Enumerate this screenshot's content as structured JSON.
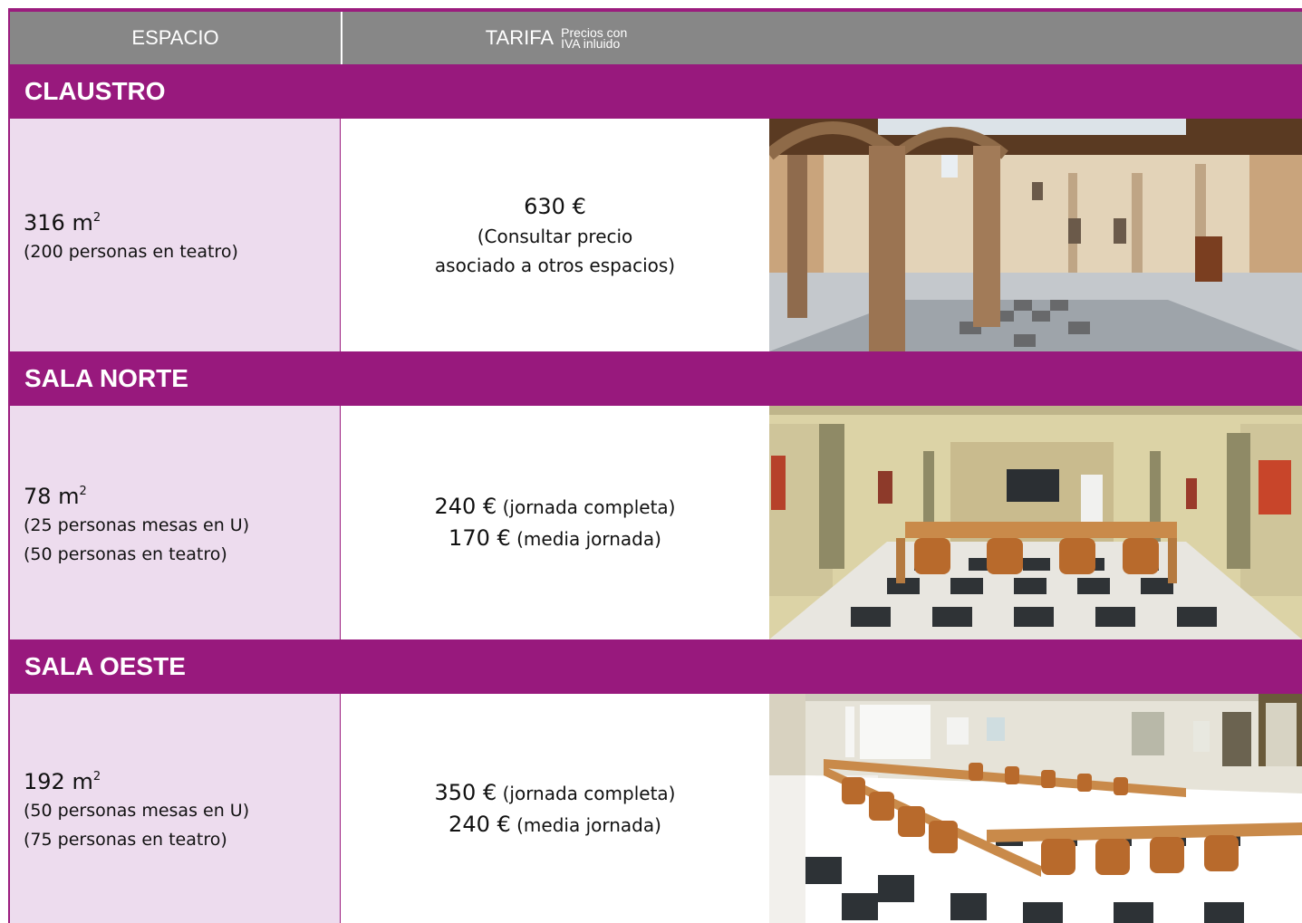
{
  "header": {
    "espacio": "ESPACIO",
    "tarifa": "TARIFA",
    "note_line1": "Precios con",
    "note_line2": "IVA inluido"
  },
  "colors": {
    "accent": "#98197d",
    "header_gray": "#878787",
    "space_bg": "#eddcee"
  },
  "sections": [
    {
      "title": "CLAUSTRO",
      "area": "316 m",
      "area_sup": "2",
      "capacity": [
        "(200 personas en teatro)"
      ],
      "price_lines": [
        {
          "amount": "630 €",
          "desc": ""
        },
        {
          "amount": "",
          "desc": "(Consultar precio"
        },
        {
          "amount": "",
          "desc": "asociado a otros espacios)"
        }
      ],
      "photo": "cloister-courtyard-photo"
    },
    {
      "title": "SALA NORTE",
      "area": "78 m",
      "area_sup": "2",
      "capacity": [
        "(25 personas mesas en U)",
        "(50 personas en teatro)"
      ],
      "price_lines": [
        {
          "amount": "240 €",
          "desc": " (jornada completa)"
        },
        {
          "amount": "170 €",
          "desc": " (media jornada)"
        }
      ],
      "photo": "meeting-room-u-tables-photo"
    },
    {
      "title": "SALA OESTE",
      "area": "192 m",
      "area_sup": "2",
      "capacity": [
        "(50 personas mesas en U)",
        "(75 personas en teatro)"
      ],
      "price_lines": [
        {
          "amount": "350 €",
          "desc": " (jornada completa)"
        },
        {
          "amount": "240 €",
          "desc": " (media jornada)"
        }
      ],
      "photo": "large-meeting-room-photo"
    }
  ]
}
